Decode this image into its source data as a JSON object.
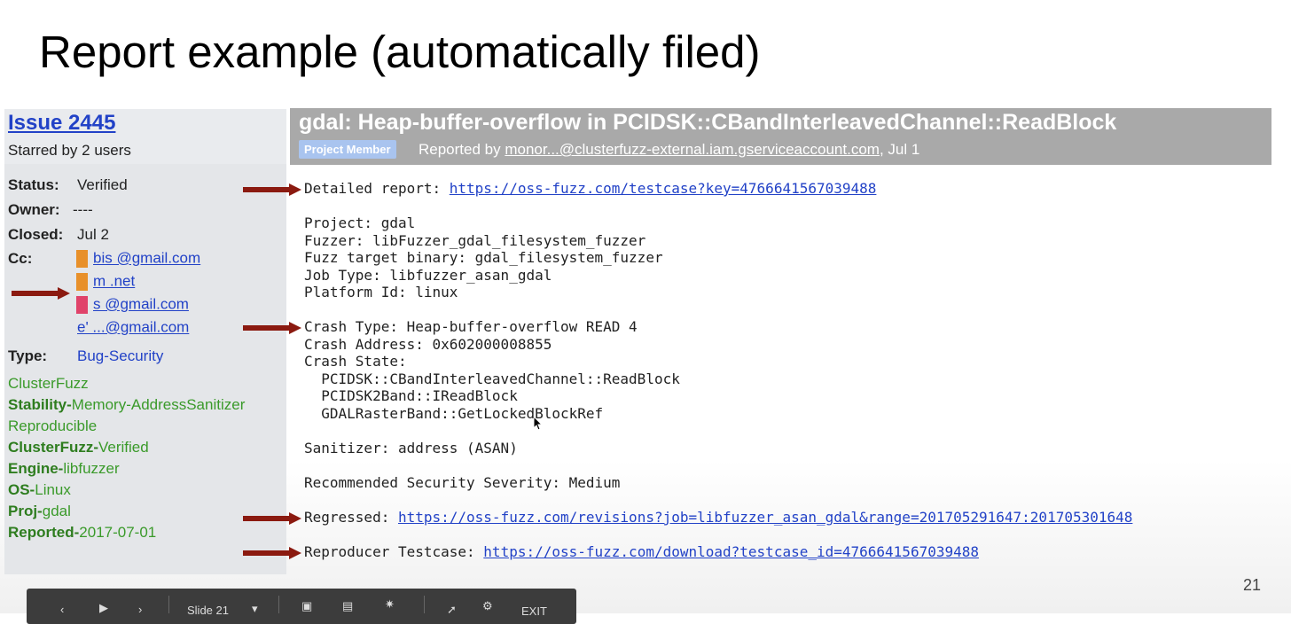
{
  "slide": {
    "title": "Report example (automatically filed)",
    "number": "21"
  },
  "issue": {
    "link": "Issue 2445",
    "starred": "Starred by 2 users",
    "status_label": "Status:",
    "status_value": "Verified",
    "owner_label": "Owner:",
    "owner_value": "----",
    "closed_label": "Closed:",
    "closed_value": "Jul 2",
    "cc_label": "Cc:",
    "cc": [
      {
        "text": "bis          @gmail.com",
        "color": "#e8902a"
      },
      {
        "text": "m                        .net",
        "color": "#e8902a"
      },
      {
        "text": "s              @gmail.com",
        "color": "#e0436a"
      },
      {
        "text": "e'              ...@gmail.com",
        "color": ""
      }
    ],
    "type_label": "Type:",
    "type_value": "Bug-Security"
  },
  "labels": [
    {
      "key": "",
      "value": "ClusterFuzz"
    },
    {
      "key": "Stability-",
      "value": "Memory-AddressSanitizer"
    },
    {
      "key": "",
      "value": "Reproducible"
    },
    {
      "key": "ClusterFuzz-",
      "value": "Verified"
    },
    {
      "key": "Engine-",
      "value": "libfuzzer"
    },
    {
      "key": "OS-",
      "value": "Linux"
    },
    {
      "key": "Proj-",
      "value": "gdal"
    },
    {
      "key": "Reported-",
      "value": "2017-07-01"
    }
  ],
  "report": {
    "title": "gdal: Heap-buffer-overflow in PCIDSK::CBandInterleavedChannel::ReadBlock",
    "badge": "Project Member",
    "reported_prefix": "Reported by ",
    "reporter": "monor...@clusterfuzz-external.iam.gserviceaccount.com",
    "reported_suffix": ", Jul 1",
    "detailed_label": "Detailed report: ",
    "detailed_url": "https://oss-fuzz.com/testcase?key=4766641567039488",
    "project": "Project: gdal",
    "fuzzer": "Fuzzer: libFuzzer_gdal_filesystem_fuzzer",
    "fuzz_target": "Fuzz target binary: gdal_filesystem_fuzzer",
    "job_type": "Job Type: libfuzzer_asan_gdal",
    "platform": "Platform Id: linux",
    "crash_type": "Crash Type: Heap-buffer-overflow READ 4",
    "crash_address": "Crash Address: 0x602000008855",
    "crash_state": "Crash State:",
    "stack": [
      "  PCIDSK::CBandInterleavedChannel::ReadBlock",
      "  PCIDSK2Band::IReadBlock",
      "  GDALRasterBand::GetLockedBlockRef"
    ],
    "sanitizer": "Sanitizer: address (ASAN)",
    "severity": "Recommended Security Severity: Medium",
    "regressed_label": "Regressed: ",
    "regressed_url": "https://oss-fuzz.com/revisions?job=libfuzzer_asan_gdal&range=201705291647:201705301648",
    "reproducer_label": "Reproducer Testcase: ",
    "reproducer_url": "https://oss-fuzz.com/download?testcase_id=4766641567039488"
  },
  "toolbar": {
    "slide_label": "Slide 21",
    "exit": "EXIT"
  },
  "colors": {
    "arrow": "#8b1a10",
    "link": "#2242c7",
    "label_green": "#3a9a2a",
    "header_gray": "#a9a9a9"
  }
}
